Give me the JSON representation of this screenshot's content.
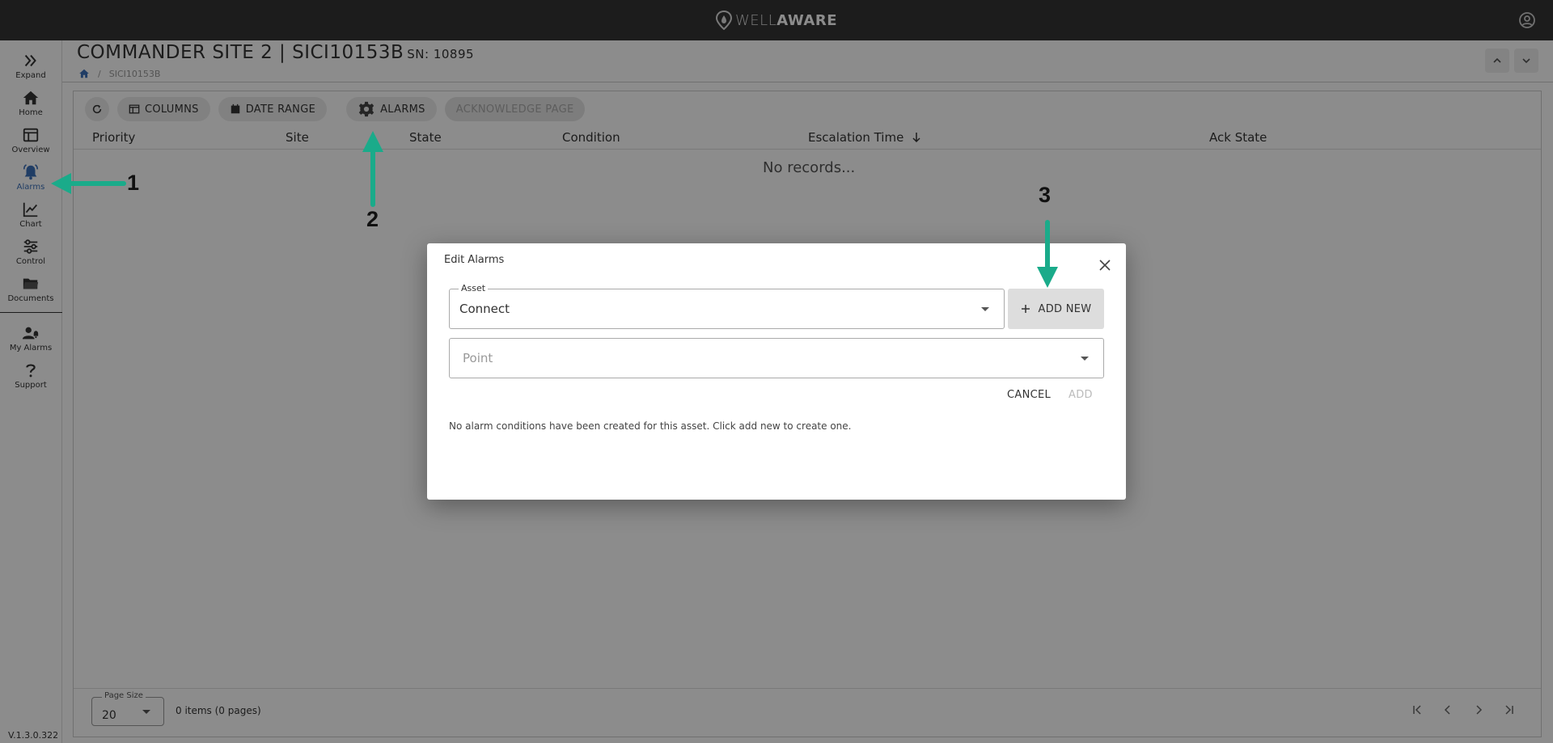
{
  "app": {
    "logo_light": "WELL",
    "logo_bold": "AWARE",
    "version": "V.1.3.0.322"
  },
  "sidebar": {
    "items": [
      {
        "label": "Expand",
        "icon": "double-chevron-right-icon"
      },
      {
        "label": "Home",
        "icon": "home-icon"
      },
      {
        "label": "Overview",
        "icon": "dashboard-icon"
      },
      {
        "label": "Alarms",
        "icon": "bell-icon",
        "active": true
      },
      {
        "label": "Chart",
        "icon": "line-chart-icon"
      },
      {
        "label": "Control",
        "icon": "sliders-icon"
      },
      {
        "label": "Documents",
        "icon": "folder-icon"
      },
      {
        "label": "My Alarms",
        "icon": "user-bell-icon"
      },
      {
        "label": "Support",
        "icon": "question-icon"
      }
    ]
  },
  "header": {
    "title": "COMMANDER SITE 2 | SICI10153B",
    "serial": "SN: 10895",
    "breadcrumb": {
      "sep": "/",
      "current": "SICI10153B"
    }
  },
  "toolbar": {
    "columns_label": "COLUMNS",
    "date_range_label": "DATE RANGE",
    "alarms_label": "ALARMS",
    "acknowledge_label": "ACKNOWLEDGE PAGE"
  },
  "grid": {
    "columns": [
      "Priority",
      "Site",
      "State",
      "Condition",
      "Escalation Time",
      "Ack State"
    ],
    "empty_text": "No records...",
    "page_size_label": "Page Size",
    "page_size_value": "20",
    "items_count": "0 items (0 pages)"
  },
  "dialog": {
    "title": "Edit Alarms",
    "asset_label": "Asset",
    "asset_value": "Connect",
    "add_new_label": "ADD NEW",
    "point_placeholder": "Point",
    "cancel_label": "CANCEL",
    "add_label": "ADD",
    "help_text": "No alarm conditions have been created for this asset. Click add new to create one."
  },
  "annotations": {
    "marker_1": "1",
    "marker_2": "2",
    "marker_3": "3",
    "arrow_color": "#1aab8a"
  },
  "colors": {
    "topbar": "#333333",
    "active_nav": "#3b6fb8",
    "overlay": "rgba(0,0,0,0.45)"
  }
}
